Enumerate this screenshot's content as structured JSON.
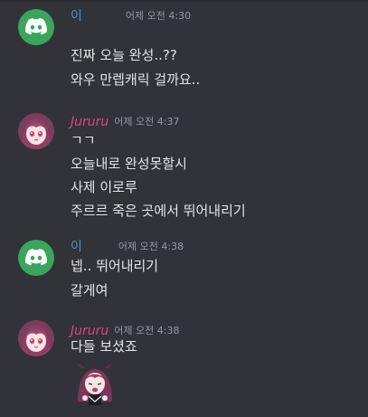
{
  "messages": [
    {
      "author": "이",
      "time": "어제 오전 4:30",
      "lines": [
        "진짜 오늘 완성..??",
        "와우 만렙캐릭 걸까요.."
      ]
    },
    {
      "author": "Jururu",
      "time": "어제 오전 4:37",
      "lines": [
        "ㄱㄱ",
        "오늘내로 완성못할시",
        "사제 이로루",
        "주르르 죽은 곳에서 뛰어내리기"
      ]
    },
    {
      "author": "이",
      "time": "어제 오전 4:38",
      "lines": [
        "넵.. 뛰어내리기",
        "갈게여"
      ]
    },
    {
      "author": "Jururu",
      "time": "어제 오전 4:38",
      "lines": [
        "다들 보셨죠"
      ]
    }
  ],
  "colors": {
    "background": "#313338",
    "username_blue": "#4b8fd6",
    "username_pink": "#e0457b",
    "discord_green": "#3ba55d",
    "timestamp": "#949ba4"
  },
  "icons": {
    "discord_avatar": "discord-logo-icon",
    "anime_avatar": "anime-girl-avatar",
    "sticker": "anime-girl-sticker"
  }
}
